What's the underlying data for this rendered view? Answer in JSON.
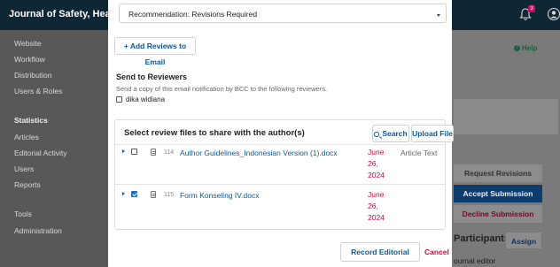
{
  "app": {
    "journal_title": "Journal of Safety, Health, a",
    "notification_count": "3"
  },
  "sidebar": {
    "items_top": [
      {
        "label": "Website"
      },
      {
        "label": "Workflow"
      },
      {
        "label": "Distribution"
      },
      {
        "label": "Users & Roles"
      }
    ],
    "statistics_heading": "Statistics",
    "statistics_items": [
      {
        "label": "Articles"
      },
      {
        "label": "Editorial Activity"
      },
      {
        "label": "Users"
      },
      {
        "label": "Reports"
      }
    ],
    "tools_label": "Tools",
    "administration_label": "Administration"
  },
  "right_panel": {
    "help_label": "Help",
    "request_revisions": "Request Revisions",
    "accept_submission": "Accept Submission",
    "decline_submission": "Decline Submission",
    "participants_heading": "Participants",
    "assign_label": "Assign",
    "journal_editor_label": "ournal editor"
  },
  "modal": {
    "recommendation_value": "Recommendation: Revisions Required",
    "add_reviews_label": "+ Add Reviews to Email",
    "send_to_reviewers_heading": "Send to Reviewers",
    "send_to_reviewers_desc": "Send a copy of this email notification by BCC to the following reviewers.",
    "reviewer_name": "dika widiana",
    "files_heading": "Select review files to share with the author(s)",
    "search_label": "Search",
    "upload_label": "Upload File",
    "files": [
      {
        "id": "114",
        "name": "Author Guidelines_Indonesian Version (1).docx",
        "date_month": "June",
        "date_day": "26,",
        "date_year": "2024",
        "type": "Article Text",
        "checked": false
      },
      {
        "id": "115",
        "name": "Form Konseling IV.docx",
        "date_month": "June",
        "date_day": "26,",
        "date_year": "2024",
        "type": "",
        "checked": true
      }
    ],
    "record_decision_label": "Record Editorial Decision",
    "cancel_label": "Cancel"
  }
}
